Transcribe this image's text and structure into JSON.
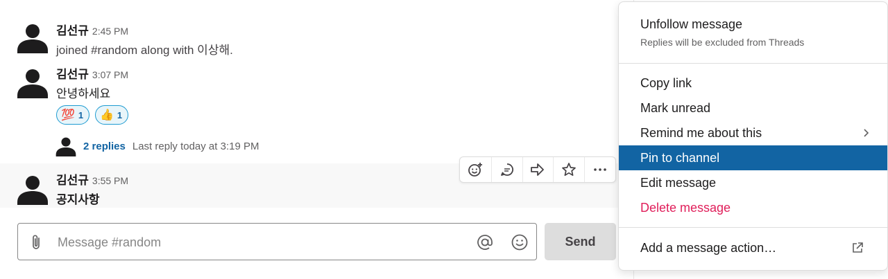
{
  "messages": [
    {
      "author": "김선규",
      "time": "2:45 PM",
      "text": "joined #random along with 이상해."
    },
    {
      "author": "김선규",
      "time": "3:07 PM",
      "text": "안녕하세요",
      "reactions": [
        {
          "emoji": "💯",
          "count": "1"
        },
        {
          "emoji": "👍",
          "count": "1"
        }
      ],
      "thread": {
        "replies": "2 replies",
        "last_reply": "Last reply today at 3:19 PM"
      }
    },
    {
      "author": "김선규",
      "time": "3:55 PM",
      "text": "공지사항"
    }
  ],
  "toolbar": {
    "icons": [
      "add-reaction-icon",
      "start-thread-icon",
      "share-icon",
      "save-star-icon",
      "more-actions-icon"
    ]
  },
  "composer": {
    "placeholder": "Message #random",
    "send_label": "Send"
  },
  "menu": {
    "unfollow": {
      "label": "Unfollow message",
      "sub": "Replies will be excluded from Threads"
    },
    "copy_link": "Copy link",
    "mark_unread": "Mark unread",
    "remind": "Remind me about this",
    "pin": "Pin to channel",
    "edit": "Edit message",
    "delete": "Delete message",
    "add_action": "Add a message action…"
  },
  "colors": {
    "accent": "#1264a3",
    "danger": "#e01e5a",
    "reaction_border": "#1d9bd1"
  }
}
